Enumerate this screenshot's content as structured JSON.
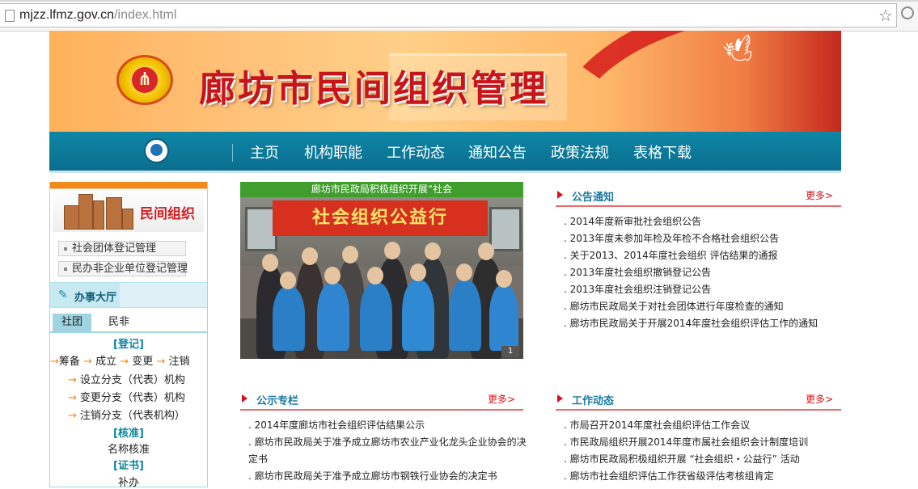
{
  "browser": {
    "url_host": "mjzz.lfmz.gov.cn",
    "url_path": "/index.html"
  },
  "banner": {
    "title": "廊坊市民间组织管理"
  },
  "nav": {
    "items": [
      "主页",
      "机构职能",
      "工作动态",
      "通知公告",
      "政策法规",
      "表格下载"
    ]
  },
  "sidebar": {
    "banner_text": "民间组织",
    "reg_buttons": [
      "社会团体登记管理",
      "民办非企业单位登记管理"
    ],
    "hall_title": "办事大厅",
    "tabs": [
      "社团",
      "民非"
    ],
    "section_dengji": "[登记]",
    "flow": [
      "筹备",
      "成立",
      "变更",
      "注销"
    ],
    "links": [
      "设立分支（代表）机构",
      "变更分支（代表）机构",
      "注销分支（代表机构）"
    ],
    "section_hezhun": "[核准]",
    "hezhun_item": "名称核准",
    "section_zhengshu": "[证书]",
    "zhengshu_item": "补办"
  },
  "photo": {
    "caption": "廊坊市民政局积极组织开展“社会",
    "sign_text": "社会组织公益行",
    "pager": "1"
  },
  "announce": {
    "title": "公告通知",
    "more": "更多>",
    "items": [
      ". 2014年度新审批社会组织公告",
      ". 2013年度未参加年检及年检不合格社会组织公告",
      ". 关于2013、2014年度社会组织  评估结果的通报",
      ". 2013年度社会组织撤销登记公告",
      ". 2013年度社会组织注销登记公告",
      ". 廊坊市民政局关于对社会团体进行年度检查的通知",
      ". 廊坊市民政局关于开展2014年度社会组织评估工作的通知"
    ]
  },
  "publicity": {
    "title": "公示专栏",
    "more": "更多>",
    "items": [
      ". 2014年度廊坊市社会组织评估结果公示",
      ". 廊坊市民政局关于准予成立廊坊市农业产业化龙头企业协会的决定书",
      ". 廊坊市民政局关于准予成立廊坊市钢铁行业协会的决定书"
    ]
  },
  "work": {
    "title": "工作动态",
    "more": "更多>",
    "items": [
      ". 市局召开2014年度社会组织评估工作会议",
      ". 市民政局组织开展2014年度市属社会组织会计制度培训",
      ". 廊坊市民政局积极组织开展 “社会组织・公益行” 活动",
      ". 廊坊市社会组织评估工作获省级评估考核组肯定"
    ]
  }
}
